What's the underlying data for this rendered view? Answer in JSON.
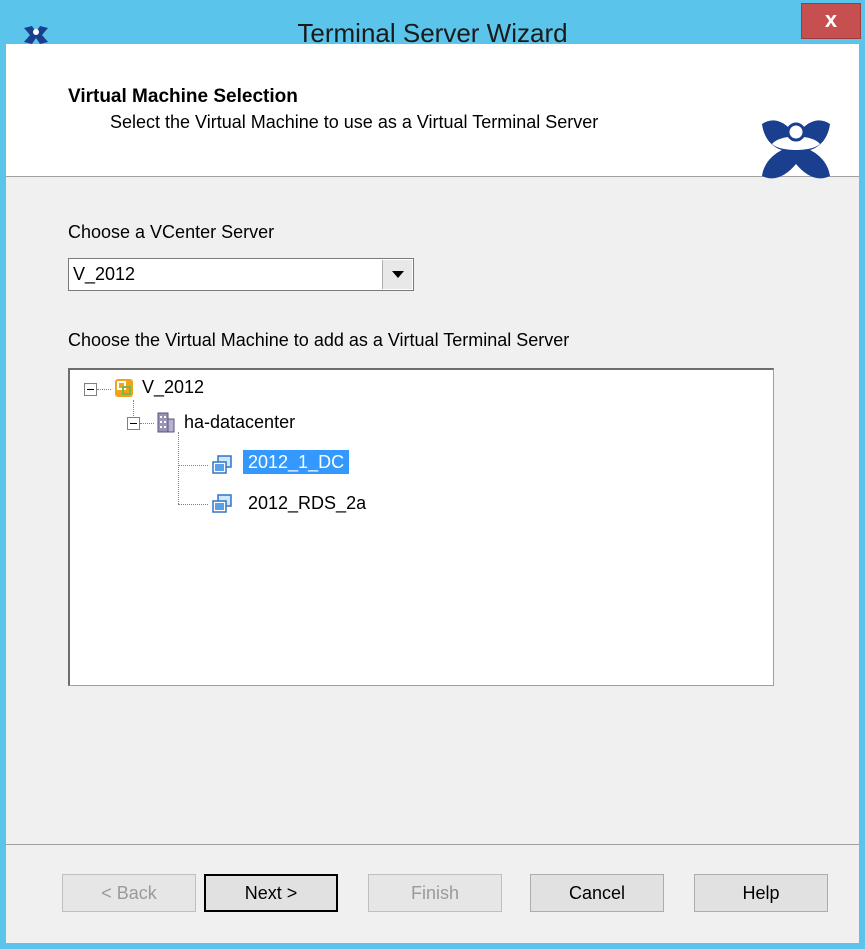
{
  "window": {
    "title": "Terminal Server Wizard",
    "close_glyph": "x"
  },
  "header": {
    "title": "Virtual Machine Selection",
    "subtitle": "Select the Virtual Machine to use as a Virtual Terminal Server",
    "logo_icon": "user-logo-icon"
  },
  "vcenter": {
    "label": "Choose a VCenter Server",
    "selected": "V_2012"
  },
  "vm": {
    "label": "Choose the Virtual Machine to add as a Virtual Terminal Server",
    "tree": {
      "root": "V_2012",
      "datacenter": "ha-datacenter",
      "vms": [
        "2012_1_DC",
        "2012_RDS_2a"
      ],
      "selected_vm": "2012_1_DC"
    }
  },
  "buttons": {
    "back": "< Back",
    "next": "Next >",
    "finish": "Finish",
    "cancel": "Cancel",
    "help": "Help"
  },
  "colors": {
    "titlebar": "#5bc4ea",
    "selection": "#3399ff",
    "close": "#c6504f",
    "logo": "#1a3f8f"
  }
}
